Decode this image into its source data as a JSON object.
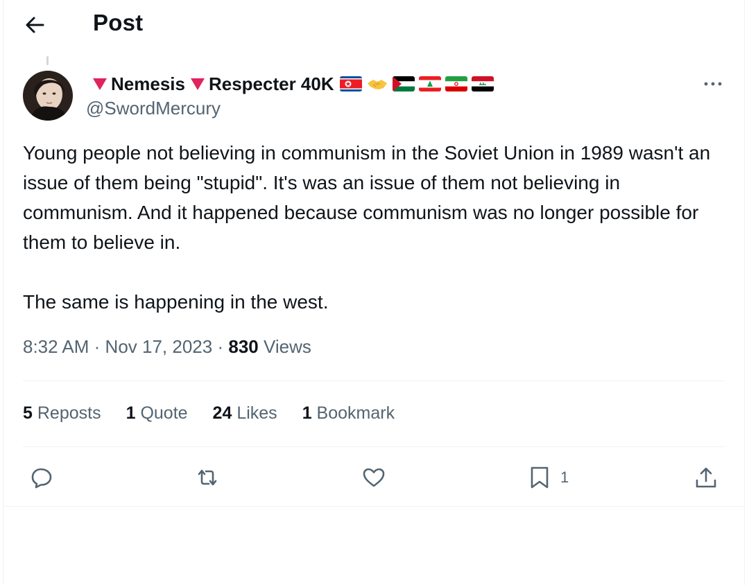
{
  "header": {
    "title": "Post",
    "back_icon": "arrow-left-icon"
  },
  "author": {
    "name_part1": "Nemesis",
    "name_part2": "Respecter 40K",
    "handle": "@SwordMercury",
    "name_emoji_color": "#e0245e",
    "flags": [
      "north-korea-flag-icon",
      "handshake-icon",
      "palestine-flag-icon",
      "lebanon-flag-icon",
      "iran-flag-icon",
      "iraq-flag-icon"
    ]
  },
  "tweet": {
    "paragraph1": "Young people not believing in communism in the Soviet Union in 1989 wasn't an issue of them being \"stupid\". It's was an issue of them not believing in communism. And it happened because communism was no longer possible for them to believe in.",
    "paragraph2": "The same is happening in the west."
  },
  "meta": {
    "time": "8:32 AM",
    "separator": "·",
    "date": "Nov 17, 2023",
    "views_count": "830",
    "views_label": "Views"
  },
  "stats": {
    "reposts_count": "5",
    "reposts_label": "Reposts",
    "quotes_count": "1",
    "quotes_label": "Quote",
    "likes_count": "24",
    "likes_label": "Likes",
    "bookmarks_count": "1",
    "bookmarks_label": "Bookmark"
  },
  "actions": {
    "bookmark_count": "1"
  },
  "colors": {
    "text": "#0f1419",
    "secondary": "#536471",
    "border": "#eff3f4"
  }
}
